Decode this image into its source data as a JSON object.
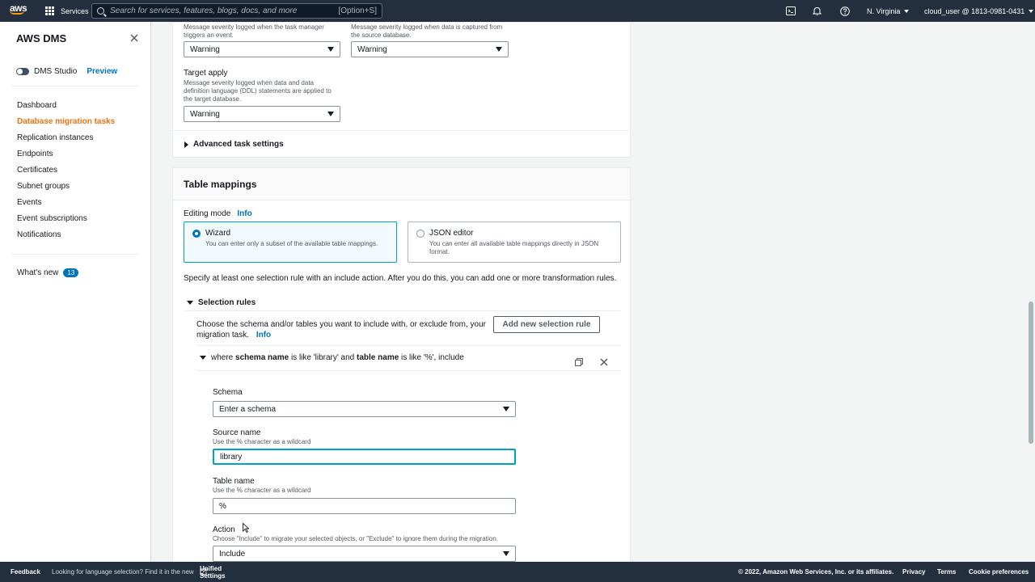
{
  "topnav": {
    "logo": "aws",
    "services_label": "Services",
    "search_placeholder": "Search for services, features, blogs, docs, and more",
    "search_shortcut": "[Option+S]",
    "region": "N. Virginia",
    "account": "cloud_user @ 1813-0981-0431",
    "icons": [
      "cloudshell-icon",
      "bell-icon",
      "help-icon"
    ]
  },
  "sidebar": {
    "title": "AWS DMS",
    "studio_label": "DMS Studio",
    "preview_label": "Preview",
    "items": [
      {
        "label": "Dashboard",
        "active": false
      },
      {
        "label": "Database migration tasks",
        "active": true
      },
      {
        "label": "Replication instances",
        "active": false
      },
      {
        "label": "Endpoints",
        "active": false
      },
      {
        "label": "Certificates",
        "active": false
      },
      {
        "label": "Subnet groups",
        "active": false
      },
      {
        "label": "Events",
        "active": false
      },
      {
        "label": "Event subscriptions",
        "active": false
      },
      {
        "label": "Notifications",
        "active": false
      }
    ],
    "whats_new": "What's new",
    "whats_new_count": "13"
  },
  "logging": {
    "task_manager_desc": "Message severity logged when the task manager triggers an event.",
    "task_manager_value": "Warning",
    "source_capture_desc": "Message severity logged when data is captured from the source database.",
    "source_capture_value": "Warning",
    "target_apply_label": "Target apply",
    "target_apply_desc": "Message severity logged when data and data definition language (DDL) statements are applied to the target database.",
    "target_apply_value": "Warning",
    "advanced_label": "Advanced task settings"
  },
  "table_mappings": {
    "title": "Table mappings",
    "editing_mode_label": "Editing mode",
    "info": "Info",
    "wizard_label": "Wizard",
    "wizard_desc": "You can enter only a subset of the available table mappings.",
    "json_label": "JSON editor",
    "json_desc": "You can enter all available table mappings directly in JSON format.",
    "instruction": "Specify at least one selection rule with an include action. After you do this, you can add one or more transformation rules.",
    "selection_rules_label": "Selection rules",
    "selection_desc": "Choose the schema and/or tables you want to include with, or exclude from, your migration task.",
    "add_rule_button": "Add new selection rule",
    "rule_summary": {
      "p1": "where ",
      "b1": "schema name",
      "p2": " is like 'library' and ",
      "b2": "table name",
      "p3": " is like '%', include"
    },
    "schema_label": "Schema",
    "schema_placeholder": "Enter a schema",
    "source_name_label": "Source name",
    "source_name_hint": "Use the % character as a wildcard",
    "source_name_value": "library",
    "table_name_label": "Table name",
    "table_name_hint": "Use the % character as a wildcard",
    "table_name_value": "%",
    "action_label": "Action",
    "action_hint": "Choose \"Include\" to migrate your selected objects, or \"Exclude\" to ignore them during the migration.",
    "action_value": "Include"
  },
  "footer": {
    "feedback": "Feedback",
    "language_text": "Looking for language selection? Find it in the new",
    "unified_settings": "Unified Settings",
    "copyright": "© 2022, Amazon Web Services, Inc. or its affiliates.",
    "privacy": "Privacy",
    "terms": "Terms",
    "cookie": "Cookie preferences"
  }
}
